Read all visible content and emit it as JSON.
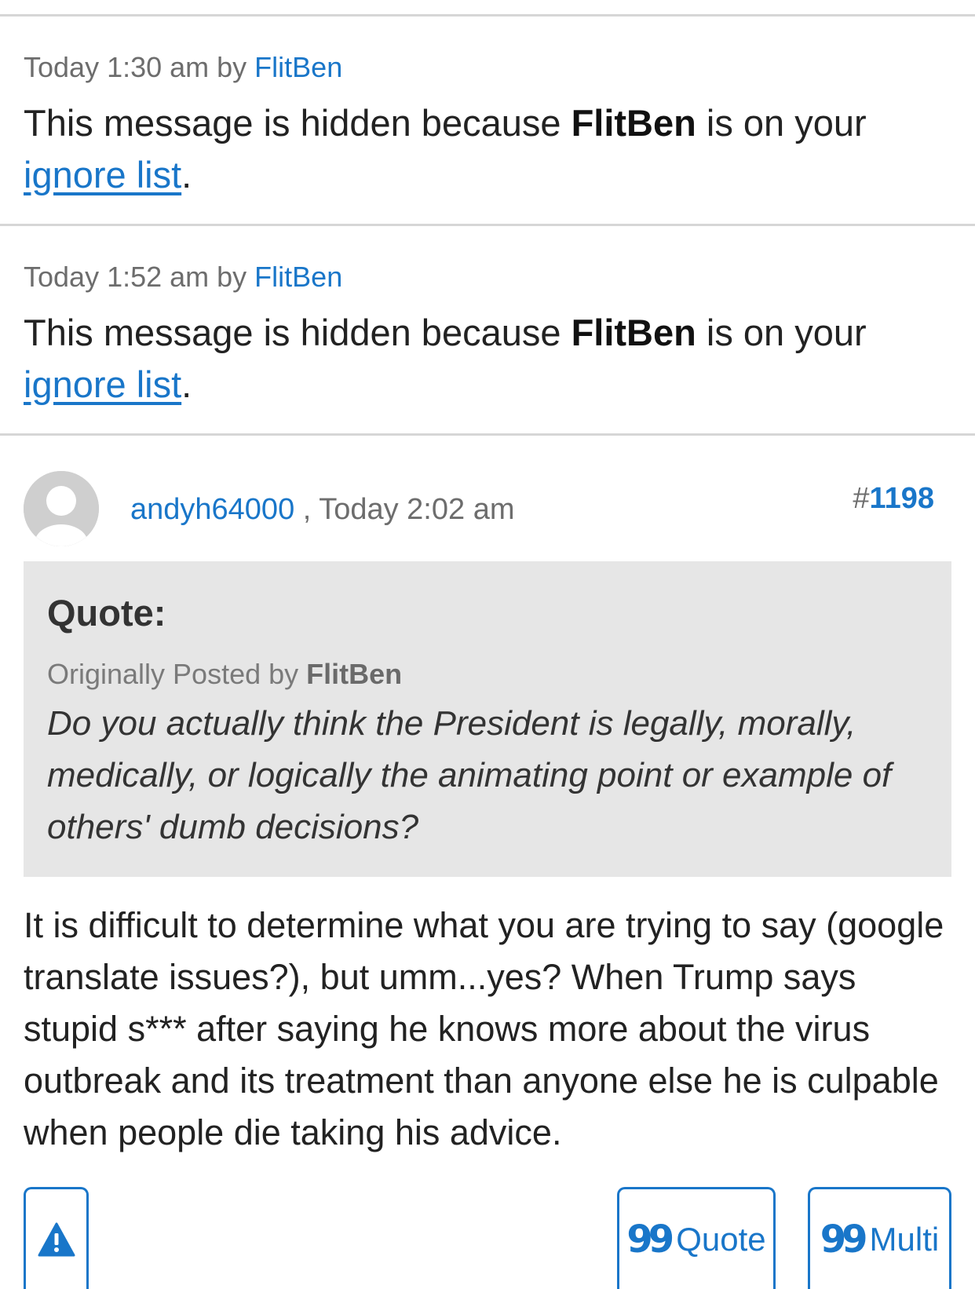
{
  "hidden_posts": [
    {
      "meta_prefix": "Today 1:30 am by ",
      "author": "FlitBen",
      "message_prefix": "This message is hidden because ",
      "message_user": "FlitBen",
      "message_suffix": " is on your",
      "link_text": "ignore list",
      "end_punct": "."
    },
    {
      "meta_prefix": "Today 1:52 am by ",
      "author": "FlitBen",
      "message_prefix": "This message is hidden because ",
      "message_user": "FlitBen",
      "message_suffix": " is on your",
      "link_text": "ignore list",
      "end_punct": "."
    }
  ],
  "post": {
    "username": "andyh64000",
    "separator": " , ",
    "timestamp": "Today 2:02 am",
    "number_hash": "#",
    "number": "1198",
    "quote": {
      "title": "Quote:",
      "origin_prefix": "Originally Posted by ",
      "origin_author": "FlitBen",
      "text": "Do you actually think the President is legally, morally, medically, or logically the animating point or example of others' dumb decisions?"
    },
    "body": "It is difficult to determine what you are trying to say (google translate issues?), but umm...yes? When Trump says stupid s*** after saying he knows more about the virus outbreak and its treatment than anyone else he is culpable when people die taking his advice."
  },
  "actions": {
    "report_icon": "warning-icon",
    "quote_label": "Quote",
    "multi_label": "Multi",
    "quote_glyph": "99"
  },
  "colors": {
    "link": "#1976c9",
    "quote_bg": "#e6e6e6",
    "divider": "#d6d6d6"
  }
}
